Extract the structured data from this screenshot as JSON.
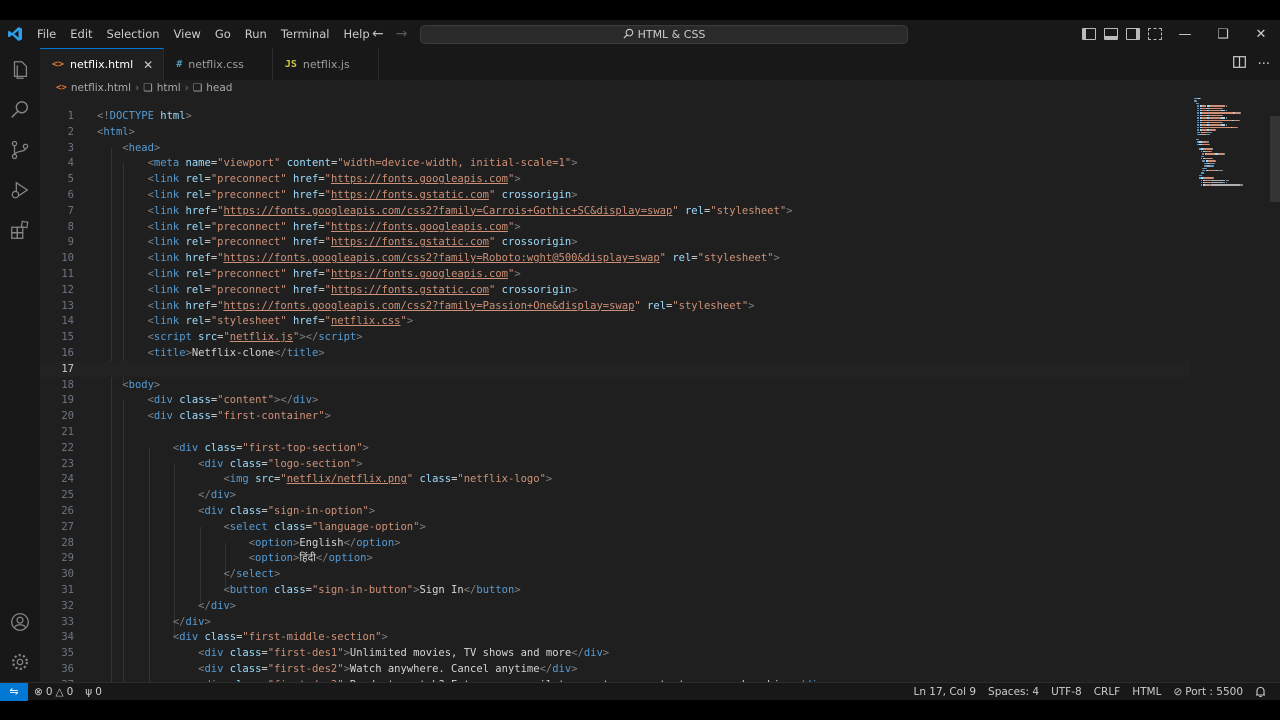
{
  "menu": [
    "File",
    "Edit",
    "Selection",
    "View",
    "Go",
    "Run",
    "Terminal",
    "Help"
  ],
  "command_center": "HTML & CSS",
  "tabs": [
    {
      "label": "netflix.html",
      "icon": "<>",
      "icon_color": "#e37933",
      "active": true
    },
    {
      "label": "netflix.css",
      "icon": "#",
      "icon_color": "#519aba",
      "active": false
    },
    {
      "label": "netflix.js",
      "icon": "JS",
      "icon_color": "#cbcb41",
      "active": false
    }
  ],
  "breadcrumb": [
    "netflix.html",
    "html",
    "head"
  ],
  "current_line": 17,
  "code_lines": [
    [
      [
        "br",
        "<!"
      ],
      [
        "tag",
        "DOCTYPE"
      ],
      [
        "text",
        " "
      ],
      [
        "attr",
        "html"
      ],
      [
        "br",
        ">"
      ]
    ],
    [
      [
        "br",
        "<"
      ],
      [
        "tag",
        "html"
      ],
      [
        "br",
        ">"
      ]
    ],
    [
      [
        "text",
        "    "
      ],
      [
        "br",
        "<"
      ],
      [
        "tag",
        "head"
      ],
      [
        "br",
        ">"
      ]
    ],
    [
      [
        "text",
        "        "
      ],
      [
        "br",
        "<"
      ],
      [
        "tag",
        "meta"
      ],
      [
        "text",
        " "
      ],
      [
        "attr",
        "name"
      ],
      [
        "text",
        "="
      ],
      [
        "str",
        "\"viewport\""
      ],
      [
        "text",
        " "
      ],
      [
        "attr",
        "content"
      ],
      [
        "text",
        "="
      ],
      [
        "str",
        "\"width=device-width, initial-scale=1\""
      ],
      [
        "br",
        ">"
      ]
    ],
    [
      [
        "text",
        "        "
      ],
      [
        "br",
        "<"
      ],
      [
        "tag",
        "link"
      ],
      [
        "text",
        " "
      ],
      [
        "attr",
        "rel"
      ],
      [
        "text",
        "="
      ],
      [
        "str",
        "\"preconnect\""
      ],
      [
        "text",
        " "
      ],
      [
        "attr",
        "href"
      ],
      [
        "text",
        "="
      ],
      [
        "str",
        "\""
      ],
      [
        "url",
        "https://fonts.googleapis.com"
      ],
      [
        "str",
        "\""
      ],
      [
        "br",
        ">"
      ]
    ],
    [
      [
        "text",
        "        "
      ],
      [
        "br",
        "<"
      ],
      [
        "tag",
        "link"
      ],
      [
        "text",
        " "
      ],
      [
        "attr",
        "rel"
      ],
      [
        "text",
        "="
      ],
      [
        "str",
        "\"preconnect\""
      ],
      [
        "text",
        " "
      ],
      [
        "attr",
        "href"
      ],
      [
        "text",
        "="
      ],
      [
        "str",
        "\""
      ],
      [
        "url",
        "https://fonts.gstatic.com"
      ],
      [
        "str",
        "\""
      ],
      [
        "text",
        " "
      ],
      [
        "attr",
        "crossorigin"
      ],
      [
        "br",
        ">"
      ]
    ],
    [
      [
        "text",
        "        "
      ],
      [
        "br",
        "<"
      ],
      [
        "tag",
        "link"
      ],
      [
        "text",
        " "
      ],
      [
        "attr",
        "href"
      ],
      [
        "text",
        "="
      ],
      [
        "str",
        "\""
      ],
      [
        "url",
        "https://fonts.googleapis.com/css2?family=Carrois+Gothic+SC&display=swap"
      ],
      [
        "str",
        "\""
      ],
      [
        "text",
        " "
      ],
      [
        "attr",
        "rel"
      ],
      [
        "text",
        "="
      ],
      [
        "str",
        "\"stylesheet\""
      ],
      [
        "br",
        ">"
      ]
    ],
    [
      [
        "text",
        "        "
      ],
      [
        "br",
        "<"
      ],
      [
        "tag",
        "link"
      ],
      [
        "text",
        " "
      ],
      [
        "attr",
        "rel"
      ],
      [
        "text",
        "="
      ],
      [
        "str",
        "\"preconnect\""
      ],
      [
        "text",
        " "
      ],
      [
        "attr",
        "href"
      ],
      [
        "text",
        "="
      ],
      [
        "str",
        "\""
      ],
      [
        "url",
        "https://fonts.googleapis.com"
      ],
      [
        "str",
        "\""
      ],
      [
        "br",
        ">"
      ]
    ],
    [
      [
        "text",
        "        "
      ],
      [
        "br",
        "<"
      ],
      [
        "tag",
        "link"
      ],
      [
        "text",
        " "
      ],
      [
        "attr",
        "rel"
      ],
      [
        "text",
        "="
      ],
      [
        "str",
        "\"preconnect\""
      ],
      [
        "text",
        " "
      ],
      [
        "attr",
        "href"
      ],
      [
        "text",
        "="
      ],
      [
        "str",
        "\""
      ],
      [
        "url",
        "https://fonts.gstatic.com"
      ],
      [
        "str",
        "\""
      ],
      [
        "text",
        " "
      ],
      [
        "attr",
        "crossorigin"
      ],
      [
        "br",
        ">"
      ]
    ],
    [
      [
        "text",
        "        "
      ],
      [
        "br",
        "<"
      ],
      [
        "tag",
        "link"
      ],
      [
        "text",
        " "
      ],
      [
        "attr",
        "href"
      ],
      [
        "text",
        "="
      ],
      [
        "str",
        "\""
      ],
      [
        "url",
        "https://fonts.googleapis.com/css2?family=Roboto:wght@500&display=swap"
      ],
      [
        "str",
        "\""
      ],
      [
        "text",
        " "
      ],
      [
        "attr",
        "rel"
      ],
      [
        "text",
        "="
      ],
      [
        "str",
        "\"stylesheet\""
      ],
      [
        "br",
        ">"
      ]
    ],
    [
      [
        "text",
        "        "
      ],
      [
        "br",
        "<"
      ],
      [
        "tag",
        "link"
      ],
      [
        "text",
        " "
      ],
      [
        "attr",
        "rel"
      ],
      [
        "text",
        "="
      ],
      [
        "str",
        "\"preconnect\""
      ],
      [
        "text",
        " "
      ],
      [
        "attr",
        "href"
      ],
      [
        "text",
        "="
      ],
      [
        "str",
        "\""
      ],
      [
        "url",
        "https://fonts.googleapis.com"
      ],
      [
        "str",
        "\""
      ],
      [
        "br",
        ">"
      ]
    ],
    [
      [
        "text",
        "        "
      ],
      [
        "br",
        "<"
      ],
      [
        "tag",
        "link"
      ],
      [
        "text",
        " "
      ],
      [
        "attr",
        "rel"
      ],
      [
        "text",
        "="
      ],
      [
        "str",
        "\"preconnect\""
      ],
      [
        "text",
        " "
      ],
      [
        "attr",
        "href"
      ],
      [
        "text",
        "="
      ],
      [
        "str",
        "\""
      ],
      [
        "url",
        "https://fonts.gstatic.com"
      ],
      [
        "str",
        "\""
      ],
      [
        "text",
        " "
      ],
      [
        "attr",
        "crossorigin"
      ],
      [
        "br",
        ">"
      ]
    ],
    [
      [
        "text",
        "        "
      ],
      [
        "br",
        "<"
      ],
      [
        "tag",
        "link"
      ],
      [
        "text",
        " "
      ],
      [
        "attr",
        "href"
      ],
      [
        "text",
        "="
      ],
      [
        "str",
        "\""
      ],
      [
        "url",
        "https://fonts.googleapis.com/css2?family=Passion+One&display=swap"
      ],
      [
        "str",
        "\""
      ],
      [
        "text",
        " "
      ],
      [
        "attr",
        "rel"
      ],
      [
        "text",
        "="
      ],
      [
        "str",
        "\"stylesheet\""
      ],
      [
        "br",
        ">"
      ]
    ],
    [
      [
        "text",
        "        "
      ],
      [
        "br",
        "<"
      ],
      [
        "tag",
        "link"
      ],
      [
        "text",
        " "
      ],
      [
        "attr",
        "rel"
      ],
      [
        "text",
        "="
      ],
      [
        "str",
        "\"stylesheet\""
      ],
      [
        "text",
        " "
      ],
      [
        "attr",
        "href"
      ],
      [
        "text",
        "="
      ],
      [
        "str",
        "\""
      ],
      [
        "url",
        "netflix.css"
      ],
      [
        "str",
        "\""
      ],
      [
        "br",
        ">"
      ]
    ],
    [
      [
        "text",
        "        "
      ],
      [
        "br",
        "<"
      ],
      [
        "tag",
        "script"
      ],
      [
        "text",
        " "
      ],
      [
        "attr",
        "src"
      ],
      [
        "text",
        "="
      ],
      [
        "str",
        "\""
      ],
      [
        "url",
        "netflix.js"
      ],
      [
        "str",
        "\""
      ],
      [
        "br",
        ">"
      ],
      [
        "br",
        "</"
      ],
      [
        "tag",
        "script"
      ],
      [
        "br",
        ">"
      ]
    ],
    [
      [
        "text",
        "        "
      ],
      [
        "br",
        "<"
      ],
      [
        "tag",
        "title"
      ],
      [
        "br",
        ">"
      ],
      [
        "text",
        "Netflix-clone"
      ],
      [
        "br",
        "</"
      ],
      [
        "tag",
        "title"
      ],
      [
        "br",
        ">"
      ]
    ],
    [
      [
        "text",
        "        "
      ]
    ],
    [
      [
        "text",
        "    "
      ],
      [
        "br",
        "<"
      ],
      [
        "tag",
        "body"
      ],
      [
        "br",
        ">"
      ]
    ],
    [
      [
        "text",
        "        "
      ],
      [
        "br",
        "<"
      ],
      [
        "tag",
        "div"
      ],
      [
        "text",
        " "
      ],
      [
        "attr",
        "class"
      ],
      [
        "text",
        "="
      ],
      [
        "str",
        "\"content\""
      ],
      [
        "br",
        ">"
      ],
      [
        "br",
        "</"
      ],
      [
        "tag",
        "div"
      ],
      [
        "br",
        ">"
      ]
    ],
    [
      [
        "text",
        "        "
      ],
      [
        "br",
        "<"
      ],
      [
        "tag",
        "div"
      ],
      [
        "text",
        " "
      ],
      [
        "attr",
        "class"
      ],
      [
        "text",
        "="
      ],
      [
        "str",
        "\"first-container\""
      ],
      [
        "br",
        ">"
      ]
    ],
    [],
    [
      [
        "text",
        "            "
      ],
      [
        "br",
        "<"
      ],
      [
        "tag",
        "div"
      ],
      [
        "text",
        " "
      ],
      [
        "attr",
        "class"
      ],
      [
        "text",
        "="
      ],
      [
        "str",
        "\"first-top-section\""
      ],
      [
        "br",
        ">"
      ]
    ],
    [
      [
        "text",
        "                "
      ],
      [
        "br",
        "<"
      ],
      [
        "tag",
        "div"
      ],
      [
        "text",
        " "
      ],
      [
        "attr",
        "class"
      ],
      [
        "text",
        "="
      ],
      [
        "str",
        "\"logo-section\""
      ],
      [
        "br",
        ">"
      ]
    ],
    [
      [
        "text",
        "                    "
      ],
      [
        "br",
        "<"
      ],
      [
        "tag",
        "img"
      ],
      [
        "text",
        " "
      ],
      [
        "attr",
        "src"
      ],
      [
        "text",
        "="
      ],
      [
        "str",
        "\""
      ],
      [
        "url",
        "netflix/netflix.png"
      ],
      [
        "str",
        "\""
      ],
      [
        "text",
        " "
      ],
      [
        "attr",
        "class"
      ],
      [
        "text",
        "="
      ],
      [
        "str",
        "\"netflix-logo\""
      ],
      [
        "br",
        ">"
      ]
    ],
    [
      [
        "text",
        "                "
      ],
      [
        "br",
        "</"
      ],
      [
        "tag",
        "div"
      ],
      [
        "br",
        ">"
      ]
    ],
    [
      [
        "text",
        "                "
      ],
      [
        "br",
        "<"
      ],
      [
        "tag",
        "div"
      ],
      [
        "text",
        " "
      ],
      [
        "attr",
        "class"
      ],
      [
        "text",
        "="
      ],
      [
        "str",
        "\"sign-in-option\""
      ],
      [
        "br",
        ">"
      ]
    ],
    [
      [
        "text",
        "                    "
      ],
      [
        "br",
        "<"
      ],
      [
        "tag",
        "select"
      ],
      [
        "text",
        " "
      ],
      [
        "attr",
        "class"
      ],
      [
        "text",
        "="
      ],
      [
        "str",
        "\"language-option\""
      ],
      [
        "br",
        ">"
      ]
    ],
    [
      [
        "text",
        "                        "
      ],
      [
        "br",
        "<"
      ],
      [
        "tag",
        "option"
      ],
      [
        "br",
        ">"
      ],
      [
        "text",
        "English"
      ],
      [
        "br",
        "</"
      ],
      [
        "tag",
        "option"
      ],
      [
        "br",
        ">"
      ]
    ],
    [
      [
        "text",
        "                        "
      ],
      [
        "br",
        "<"
      ],
      [
        "tag",
        "option"
      ],
      [
        "br",
        ">"
      ],
      [
        "text",
        "हिंदी"
      ],
      [
        "br",
        "</"
      ],
      [
        "tag",
        "option"
      ],
      [
        "br",
        ">"
      ]
    ],
    [
      [
        "text",
        "                    "
      ],
      [
        "br",
        "</"
      ],
      [
        "tag",
        "select"
      ],
      [
        "br",
        ">"
      ]
    ],
    [
      [
        "text",
        "                    "
      ],
      [
        "br",
        "<"
      ],
      [
        "tag",
        "button"
      ],
      [
        "text",
        " "
      ],
      [
        "attr",
        "class"
      ],
      [
        "text",
        "="
      ],
      [
        "str",
        "\"sign-in-button\""
      ],
      [
        "br",
        ">"
      ],
      [
        "text",
        "Sign In"
      ],
      [
        "br",
        "</"
      ],
      [
        "tag",
        "button"
      ],
      [
        "br",
        ">"
      ]
    ],
    [
      [
        "text",
        "                "
      ],
      [
        "br",
        "</"
      ],
      [
        "tag",
        "div"
      ],
      [
        "br",
        ">"
      ]
    ],
    [
      [
        "text",
        "            "
      ],
      [
        "br",
        "</"
      ],
      [
        "tag",
        "div"
      ],
      [
        "br",
        ">"
      ]
    ],
    [
      [
        "text",
        "            "
      ],
      [
        "br",
        "<"
      ],
      [
        "tag",
        "div"
      ],
      [
        "text",
        " "
      ],
      [
        "attr",
        "class"
      ],
      [
        "text",
        "="
      ],
      [
        "str",
        "\"first-middle-section\""
      ],
      [
        "br",
        ">"
      ]
    ],
    [
      [
        "text",
        "                "
      ],
      [
        "br",
        "<"
      ],
      [
        "tag",
        "div"
      ],
      [
        "text",
        " "
      ],
      [
        "attr",
        "class"
      ],
      [
        "text",
        "="
      ],
      [
        "str",
        "\"first-des1\""
      ],
      [
        "br",
        ">"
      ],
      [
        "text",
        "Unlimited movies, TV shows and more"
      ],
      [
        "br",
        "</"
      ],
      [
        "tag",
        "div"
      ],
      [
        "br",
        ">"
      ]
    ],
    [
      [
        "text",
        "                "
      ],
      [
        "br",
        "<"
      ],
      [
        "tag",
        "div"
      ],
      [
        "text",
        " "
      ],
      [
        "attr",
        "class"
      ],
      [
        "text",
        "="
      ],
      [
        "str",
        "\"first-des2\""
      ],
      [
        "br",
        ">"
      ],
      [
        "text",
        "Watch anywhere. Cancel anytime"
      ],
      [
        "br",
        "</"
      ],
      [
        "tag",
        "div"
      ],
      [
        "br",
        ">"
      ]
    ],
    [
      [
        "text",
        "                "
      ],
      [
        "br",
        "<"
      ],
      [
        "tag",
        "div"
      ],
      [
        "text",
        " "
      ],
      [
        "attr",
        "class"
      ],
      [
        "text",
        "="
      ],
      [
        "str",
        "\"first-des3\""
      ],
      [
        "br",
        ">"
      ],
      [
        "text",
        "Ready to watch? Enter your email to create or restart your membership."
      ],
      [
        "br",
        "</"
      ],
      [
        "tag",
        "div"
      ],
      [
        "br",
        ">"
      ]
    ]
  ],
  "status": {
    "errors": "0",
    "warnings": "0",
    "ports": "0",
    "position": "Ln 17, Col 9",
    "spaces": "Spaces: 4",
    "encoding": "UTF-8",
    "eol": "CRLF",
    "language": "HTML",
    "port": "Port : 5500"
  }
}
